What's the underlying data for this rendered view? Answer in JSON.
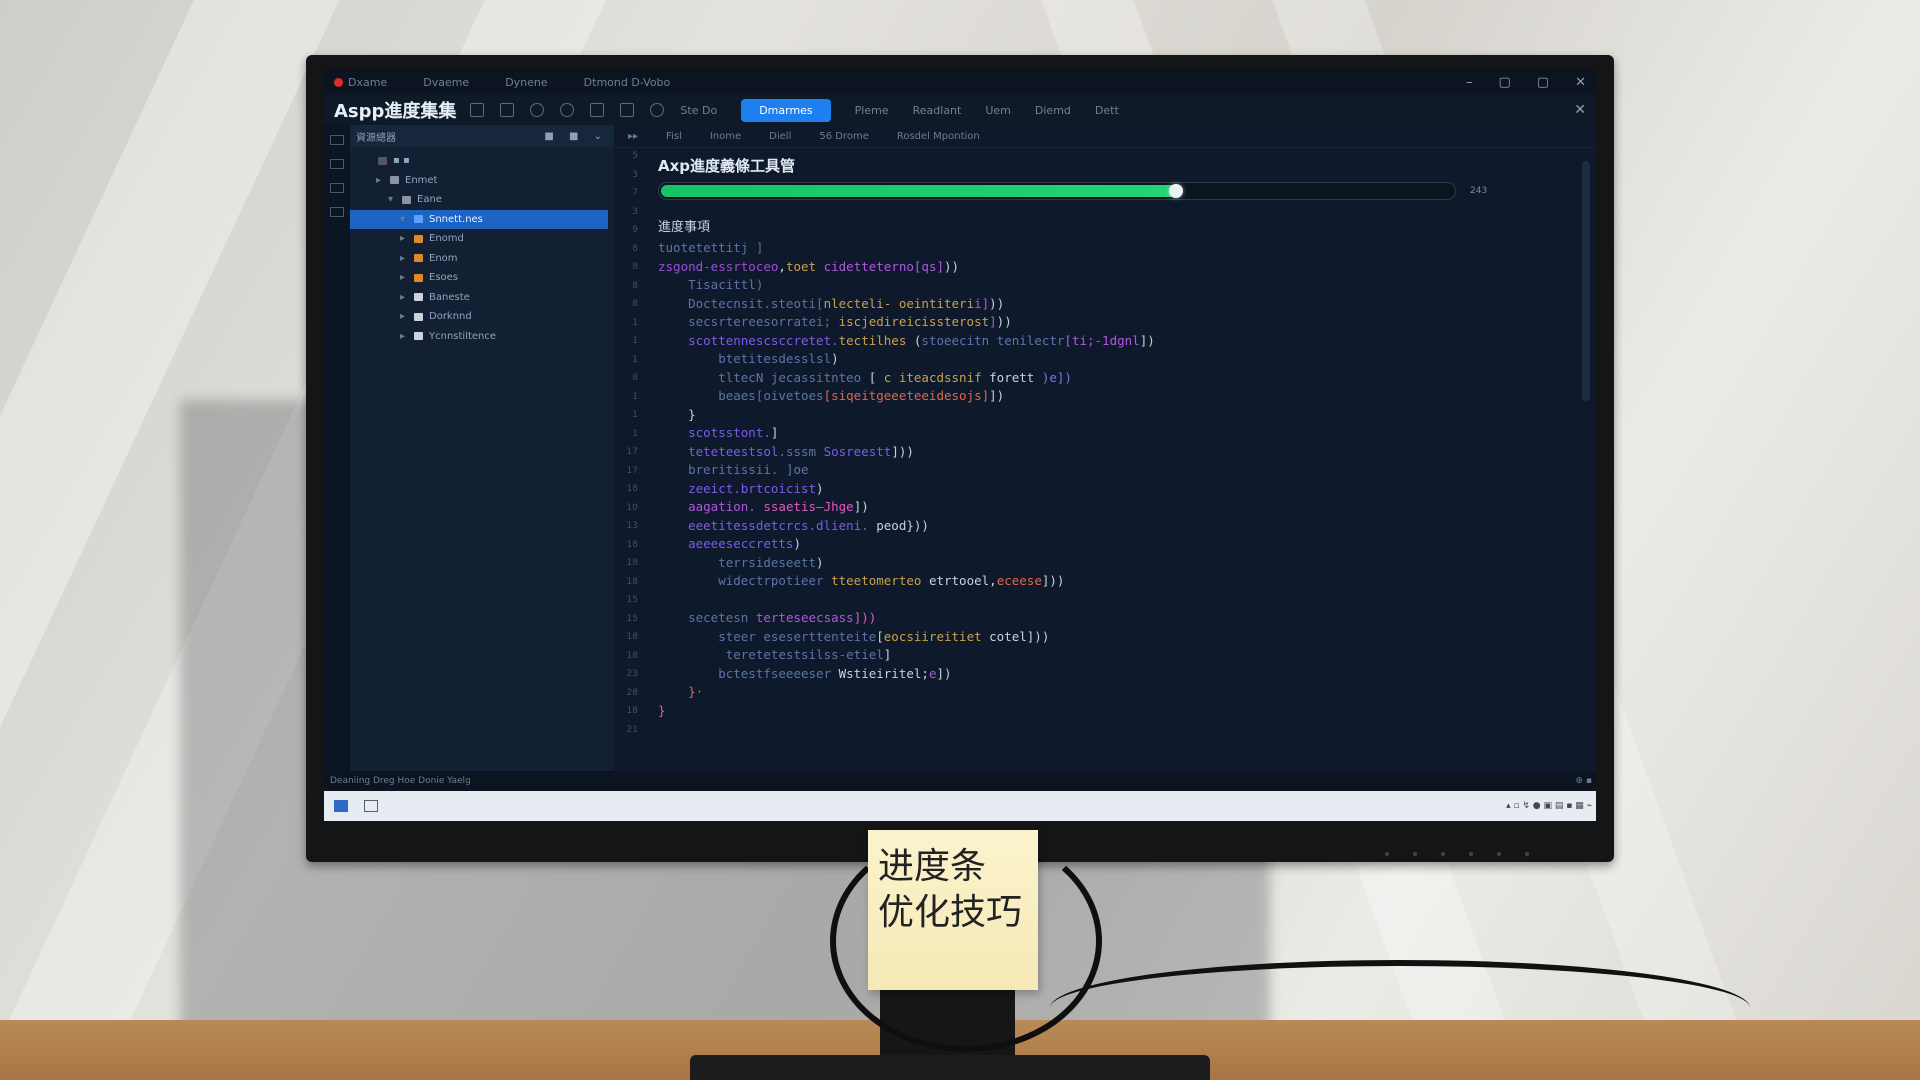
{
  "app": {
    "titlebar_menus": [
      "Dxame",
      "Dvaeme",
      "Dynene",
      "Dtmond D-Vobo"
    ],
    "window_controls": [
      "–",
      "▢",
      "▢",
      "✕"
    ],
    "name": "Aspp進度集集",
    "toolbar_tabs": [
      "Ste Do",
      "Pleme",
      "Readlant",
      "Uem",
      "Diemd",
      "Dett"
    ],
    "toolbar_active_tab": "Dmarmes",
    "close": "✕"
  },
  "sidebar": {
    "header": "資源總器",
    "header_tools": "■ ■ ⌄",
    "items": [
      {
        "label": "▪ ▪",
        "indent": 0,
        "exp": "",
        "color": "#556"
      },
      {
        "label": "Enmet",
        "indent": 1,
        "exp": "▸",
        "color": "#8a94a2"
      },
      {
        "label": "Eane",
        "indent": 2,
        "exp": "▾",
        "color": "#8a94a2"
      },
      {
        "label": "Snnett.nes",
        "indent": 3,
        "exp": "▾",
        "color": "#5aa0ff",
        "selected": true
      },
      {
        "label": "Enomd",
        "indent": 3,
        "exp": "▸",
        "color": "#e0892c"
      },
      {
        "label": "Enom",
        "indent": 3,
        "exp": "▸",
        "color": "#e0892c"
      },
      {
        "label": "Esoes",
        "indent": 3,
        "exp": "▸",
        "color": "#e0892c"
      },
      {
        "label": "Baneste",
        "indent": 3,
        "exp": "▸",
        "color": "#cdd3dc"
      },
      {
        "label": "Dorknnd",
        "indent": 3,
        "exp": "▸",
        "color": "#cdd3dc"
      },
      {
        "label": "Ycnnstiltence",
        "indent": 3,
        "exp": "▸",
        "color": "#cdd3dc"
      }
    ]
  },
  "editor": {
    "tabs": [
      "▸▸",
      "Fisl",
      "Inome",
      "Diell",
      "56 Drome",
      "Rosdel Mpontion"
    ],
    "heading": "Axp進度義條工具管",
    "progress": {
      "value": 0.65,
      "label": "243"
    },
    "subheading": "進度事項",
    "gutter": [
      "5",
      "3",
      "7",
      "3",
      "9",
      "8",
      "8",
      "8",
      "8",
      "1",
      "1",
      "1",
      "8",
      "1",
      "1",
      "1",
      "17",
      "17",
      "18",
      "10",
      "13",
      "18",
      "18",
      "18",
      "15",
      "15",
      "18",
      "18",
      "23",
      "28",
      "18",
      "21"
    ],
    "code_lines": [
      [
        {
          "t": "tuotetettitj",
          "c": "#5e72a8"
        },
        {
          "t": " ]",
          "c": "#5e72a8"
        }
      ],
      [
        {
          "t": "zsgond-essrtoceo",
          "c": "#9b4fd8"
        },
        {
          "t": ",",
          "c": "#c8d0dd"
        },
        {
          "t": "toet",
          "c": "#c9a04a"
        },
        {
          "t": " cidetteterno[qs]",
          "c": "#b057e0"
        },
        {
          "t": "))",
          "c": "#c8d0dd"
        }
      ],
      [
        {
          "t": "    Tisacittl",
          "c": "#5e72a8"
        },
        {
          "t": ")",
          "c": "#5e72a8"
        }
      ],
      [
        {
          "t": "    Doctecnsit.steoti[",
          "c": "#5e72a8"
        },
        {
          "t": "nlecteli- ",
          "c": "#c9a04a"
        },
        {
          "t": "oeintiteri",
          "c": "#c9a04a"
        },
        {
          "t": "i]",
          "c": "#b057e0"
        },
        {
          "t": "))",
          "c": "#c8d0dd"
        }
      ],
      [
        {
          "t": "    secsrtereesorratei;",
          "c": "#5e72a8"
        },
        {
          "t": " iscjedireicissterost",
          "c": "#c9a04a"
        },
        {
          "t": "]",
          "c": "#b057e0"
        },
        {
          "t": "))",
          "c": "#c8d0dd"
        }
      ],
      [
        {
          "t": "    scottennescsccretet.",
          "c": "#7d5ce8"
        },
        {
          "t": "tectilhes",
          "c": "#c9a04a"
        },
        {
          "t": " (",
          "c": "#c8d0dd"
        },
        {
          "t": "stoeecitn tenilectr",
          "c": "#5e72a8"
        },
        {
          "t": "[ti;-1dgnl",
          "c": "#b057e0"
        },
        {
          "t": "])",
          "c": "#c8d0dd"
        }
      ],
      [
        {
          "t": "        btetitesdesslsl",
          "c": "#5e72a8"
        },
        {
          "t": ")",
          "c": "#c8d0dd"
        }
      ],
      [
        {
          "t": "        tltecN jecassitnteo",
          "c": "#5e72a8"
        },
        {
          "t": " [",
          "c": "#c8d0dd"
        },
        {
          "t": " c iteacdssnif",
          "c": "#c9a04a"
        },
        {
          "t": " forett",
          "c": "#c8d0dd"
        },
        {
          "t": " )e])",
          "c": "#8a6cf0"
        }
      ],
      [
        {
          "t": "        beaes[oivetoes",
          "c": "#5e72a8"
        },
        {
          "t": "[siqeitgeeeteeidesojs]",
          "c": "#e0664a"
        },
        {
          "t": "])",
          "c": "#c8d0dd"
        }
      ],
      [
        {
          "t": "    }",
          "c": "#c8d0dd"
        }
      ],
      [
        {
          "t": "    scotsstont.",
          "c": "#7d5ce8"
        },
        {
          "t": "]",
          "c": "#c8d0dd"
        }
      ],
      [
        {
          "t": "    teteteestsol",
          "c": "#7d5ce8"
        },
        {
          "t": ".sssm ",
          "c": "#5e72a8"
        },
        {
          "t": "Sosreestt",
          "c": "#7d5ce8"
        },
        {
          "t": "]))",
          "c": "#c8d0dd"
        }
      ],
      [
        {
          "t": "    breritissii.",
          "c": "#5e72a8"
        },
        {
          "t": " ]oe",
          "c": "#5e72a8"
        }
      ],
      [
        {
          "t": "    zeeict.brtcoicist",
          "c": "#7d5ce8"
        },
        {
          "t": ")",
          "c": "#c8d0dd"
        }
      ],
      [
        {
          "t": "    aagation.",
          "c": "#b057e0"
        },
        {
          "t": " ssaetis—Jhge",
          "c": "#e05ac0"
        },
        {
          "t": "])",
          "c": "#c8d0dd"
        }
      ],
      [
        {
          "t": "    eeetitessdetcrcs.dlieni.",
          "c": "#7d5ce8"
        },
        {
          "t": " peod",
          "c": "#c8d0dd"
        },
        {
          "t": "}))",
          "c": "#c8d0dd"
        }
      ],
      [
        {
          "t": "    aeeeeseccretts",
          "c": "#7d5ce8"
        },
        {
          "t": ")",
          "c": "#c8d0dd"
        }
      ],
      [
        {
          "t": "        terrsideseett",
          "c": "#5e72a8"
        },
        {
          "t": ")",
          "c": "#c8d0dd"
        }
      ],
      [
        {
          "t": "        widectrpotieer",
          "c": "#5e72a8"
        },
        {
          "t": " tteetomerteo",
          "c": "#c9a04a"
        },
        {
          "t": " etrtooel",
          "c": "#c8d0dd"
        },
        {
          "t": ",",
          "c": "#c8d0dd"
        },
        {
          "t": "eceese",
          "c": "#e0664a"
        },
        {
          "t": "]))",
          "c": "#c8d0dd"
        }
      ],
      [
        {
          "t": "",
          "c": "#c8d0dd"
        }
      ],
      [
        {
          "t": "    secetesn ",
          "c": "#5e72a8"
        },
        {
          "t": "terteseecsass",
          "c": "#b057e0"
        },
        {
          "t": "]))",
          "c": "#e05ac0"
        }
      ],
      [
        {
          "t": "        steer eseserttenteite",
          "c": "#5e72a8"
        },
        {
          "t": "[",
          "c": "#c8d0dd"
        },
        {
          "t": "eocsiireitiet",
          "c": "#c9a04a"
        },
        {
          "t": " cotel",
          "c": "#c8d0dd"
        },
        {
          "t": "]))",
          "c": "#c8d0dd"
        }
      ],
      [
        {
          "t": "         teretetestsilss-etiel",
          "c": "#5e72a8"
        },
        {
          "t": "]",
          "c": "#c8d0dd"
        }
      ],
      [
        {
          "t": "        bctestfseeeeser",
          "c": "#5e72a8"
        },
        {
          "t": " Wstieiritel",
          "c": "#c8d0dd"
        },
        {
          "t": ";",
          "c": "#c8d0dd"
        },
        {
          "t": "e",
          "c": "#b057e0"
        },
        {
          "t": "])",
          "c": "#c8d0dd"
        }
      ],
      [
        {
          "t": "    }·",
          "c": "#e0664a"
        }
      ],
      [
        {
          "t": "}",
          "c": "#e05ac0"
        }
      ]
    ]
  },
  "statusbar": {
    "left": "Deaniing Dreg Hoe Donie Yaelg",
    "right": "⊕  ▪"
  },
  "taskbar": {
    "tray": "▴  ▫  ↯  ●  ▣  ▤  ▪  ▦  ⌁"
  },
  "note": {
    "line1": "进度条",
    "line2": "优化技巧"
  }
}
